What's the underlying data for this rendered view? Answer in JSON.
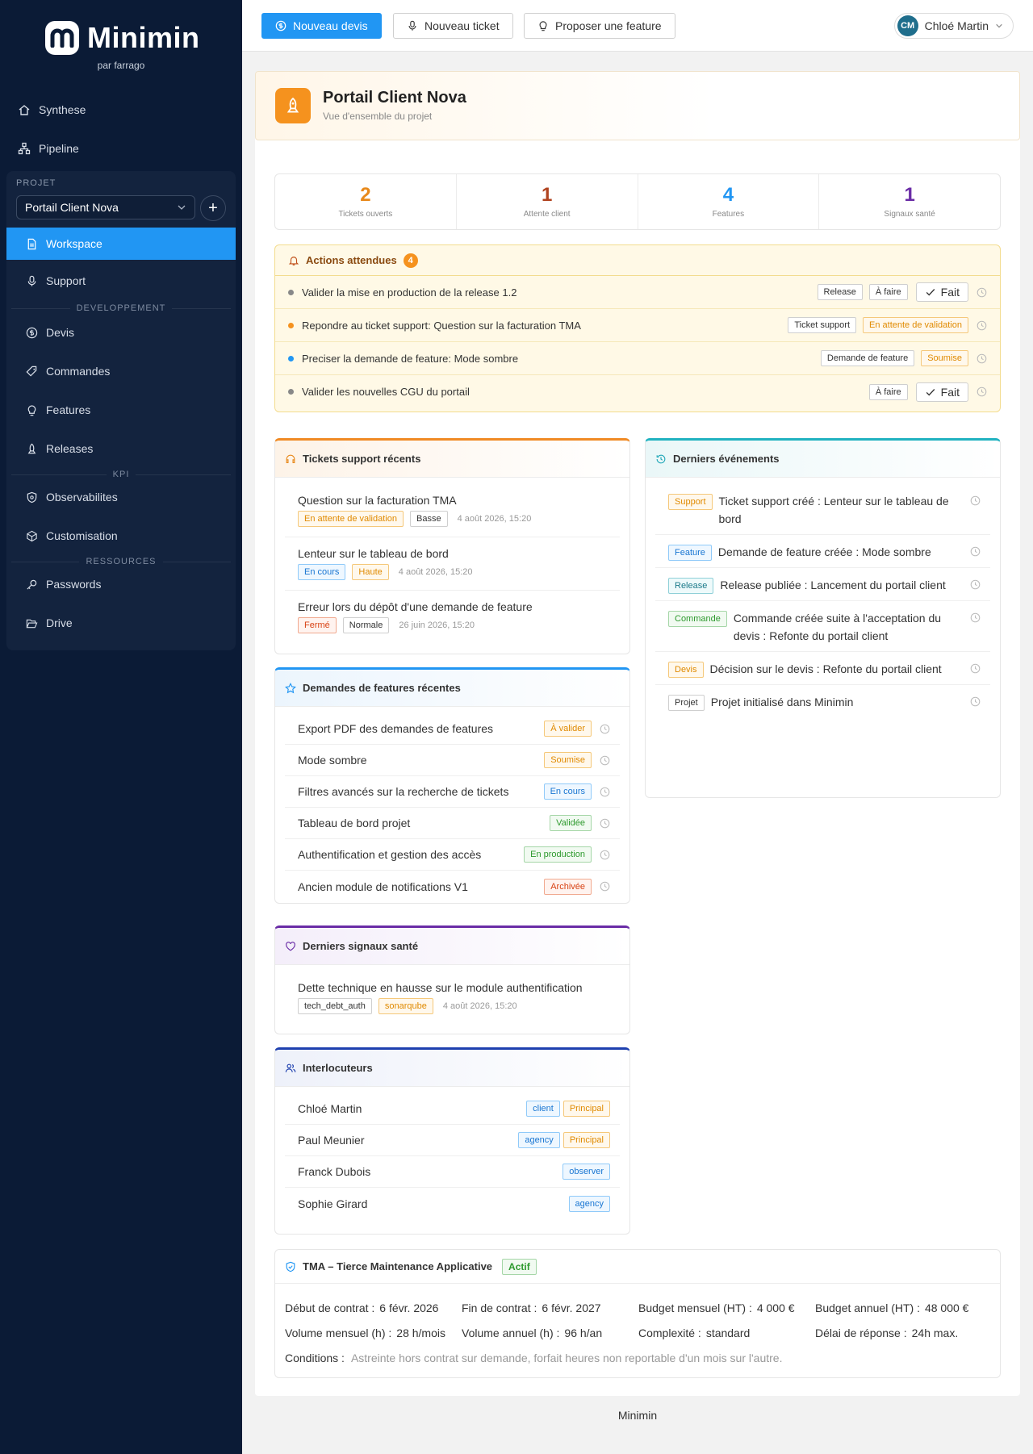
{
  "brand": {
    "name": "Minimin",
    "sub": "par farrago"
  },
  "nav": {
    "synthese": "Synthese",
    "pipeline": "Pipeline"
  },
  "project_panel": {
    "label": "PROJET",
    "selected": "Portail Client Nova",
    "add": "+",
    "items": {
      "workspace": "Workspace",
      "support": "Support",
      "devis": "Devis",
      "commandes": "Commandes",
      "features": "Features",
      "releases": "Releases",
      "observabilites": "Observabilites",
      "customisation": "Customisation",
      "passwords": "Passwords",
      "drive": "Drive"
    },
    "sections": {
      "dev": "DEVELOPPEMENT",
      "kpi": "KPI",
      "ressources": "RESSOURCES"
    }
  },
  "topbar": {
    "nouveau_devis": "Nouveau devis",
    "nouveau_ticket": "Nouveau ticket",
    "proposer": "Proposer une feature",
    "user_initials": "CM",
    "user_name": "Chloé Martin"
  },
  "header": {
    "title": "Portail Client Nova",
    "subtitle": "Vue d'ensemble du projet"
  },
  "stats": [
    {
      "value": "2",
      "label": "Tickets ouverts",
      "color": "#e8891a"
    },
    {
      "value": "1",
      "label": "Attente client",
      "color": "#b0431f"
    },
    {
      "value": "4",
      "label": "Features",
      "color": "#2196f3"
    },
    {
      "value": "1",
      "label": "Signaux santé",
      "color": "#6a2ca6"
    }
  ],
  "actions": {
    "title": "Actions attendues",
    "count": "4",
    "fait": "Fait",
    "rows": [
      {
        "text": "Valider la mise en production de la release 1.2",
        "tag1": "Release",
        "tag2": "À faire",
        "dot": "#888888"
      },
      {
        "text": "Repondre au ticket support: Question sur la facturation TMA",
        "tag1": "Ticket support",
        "tag2": "En attente de validation",
        "dot": "#f5921e"
      },
      {
        "text": "Preciser la demande de feature: Mode sombre",
        "tag1": "Demande de feature",
        "tag2": "Soumise",
        "dot": "#2196f3"
      },
      {
        "text": "Valider les nouvelles CGU du portail",
        "tag1": "À faire",
        "dot": "#888888"
      }
    ]
  },
  "tickets": {
    "title": "Tickets support récents",
    "rows": [
      {
        "title": "Question sur la facturation TMA",
        "status": "En attente de validation",
        "priority": "Basse",
        "date": "4 août 2026, 15:20"
      },
      {
        "title": "Lenteur sur le tableau de bord",
        "status": "En cours",
        "priority": "Haute",
        "date": "4 août 2026, 15:20"
      },
      {
        "title": "Erreur lors du dépôt d'une demande de feature",
        "status": "Fermé",
        "priority": "Normale",
        "date": "26 juin 2026, 15:20"
      }
    ]
  },
  "features": {
    "title": "Demandes de features récentes",
    "rows": [
      {
        "title": "Export PDF des demandes de features",
        "status": "À valider"
      },
      {
        "title": "Mode sombre",
        "status": "Soumise"
      },
      {
        "title": "Filtres avancés sur la recherche de tickets",
        "status": "En cours"
      },
      {
        "title": "Tableau de bord projet",
        "status": "Validée"
      },
      {
        "title": "Authentification et gestion des accès",
        "status": "En production"
      },
      {
        "title": "Ancien module de notifications V1",
        "status": "Archivée"
      }
    ]
  },
  "signals": {
    "title": "Derniers signaux santé",
    "rows": [
      {
        "title": "Dette technique en hausse sur le module authentification",
        "tag1": "tech_debt_auth",
        "tag2": "sonarqube",
        "date": "4 août 2026, 15:20"
      }
    ]
  },
  "contacts": {
    "title": "Interlocuteurs",
    "rows": [
      {
        "name": "Chloé Martin",
        "role": "client",
        "extra": "Principal"
      },
      {
        "name": "Paul Meunier",
        "role": "agency",
        "extra": "Principal"
      },
      {
        "name": "Franck Dubois",
        "role": "observer"
      },
      {
        "name": "Sophie Girard",
        "role": "agency"
      }
    ]
  },
  "events": {
    "title": "Derniers événements",
    "rows": [
      {
        "tag": "Support",
        "text": "Ticket support créé : Lenteur sur le tableau de bord"
      },
      {
        "tag": "Feature",
        "text": "Demande de feature créée : Mode sombre"
      },
      {
        "tag": "Release",
        "text": "Release publiée : Lancement du portail client"
      },
      {
        "tag": "Commande",
        "text": "Commande créée suite à l'acceptation du devis : Refonte du portail client"
      },
      {
        "tag": "Devis",
        "text": "Décision sur le devis : Refonte du portail client"
      },
      {
        "tag": "Projet",
        "text": "Projet initialisé dans Minimin"
      }
    ]
  },
  "tma": {
    "title": "TMA – Tierce Maintenance Applicative",
    "status": "Actif",
    "debut_k": "Début de contrat :",
    "debut_v": "6 févr. 2026",
    "fin_k": "Fin de contrat :",
    "fin_v": "6 févr. 2027",
    "bm_k": "Budget mensuel (HT) :",
    "bm_v": "4 000 €",
    "ba_k": "Budget annuel (HT) :",
    "ba_v": "48 000 €",
    "vm_k": "Volume mensuel (h) :",
    "vm_v": "28 h/mois",
    "va_k": "Volume annuel (h) :",
    "va_v": "96 h/an",
    "cx_k": "Complexité :",
    "cx_v": "standard",
    "dr_k": "Délai de réponse :",
    "dr_v": "24h max.",
    "cond_k": "Conditions :",
    "cond_v": "Astreinte hors contrat sur demande, forfait heures non reportable d'un mois sur l'autre."
  },
  "footer": "Minimin"
}
